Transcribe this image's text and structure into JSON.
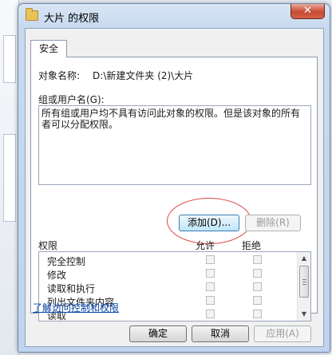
{
  "window": {
    "title": "大片 的权限",
    "close_glyph": "✕"
  },
  "tab": {
    "label": "安全"
  },
  "object": {
    "label": "对象名称:",
    "value": "D:\\新建文件夹 (2)\\大片"
  },
  "groups": {
    "label": "组或用户名(G):",
    "message": "所有组或用户均不具有访问此对象的权限。但是该对象的所有者可以分配权限。"
  },
  "buttons": {
    "add": "添加(D)...",
    "remove": "删除(R)",
    "ok": "确定",
    "cancel": "取消",
    "apply": "应用(A)"
  },
  "permissions": {
    "header": "权限",
    "allow": "允许",
    "deny": "拒绝",
    "items": [
      "完全控制",
      "修改",
      "读取和执行",
      "列出文件夹内容",
      "读取"
    ]
  },
  "link": {
    "label": "了解访问控制和权限"
  },
  "icons": {
    "folder": "folder-icon",
    "close": "close-icon",
    "scroll_up": "scroll-up-icon",
    "scroll_down": "scroll-down-icon"
  }
}
